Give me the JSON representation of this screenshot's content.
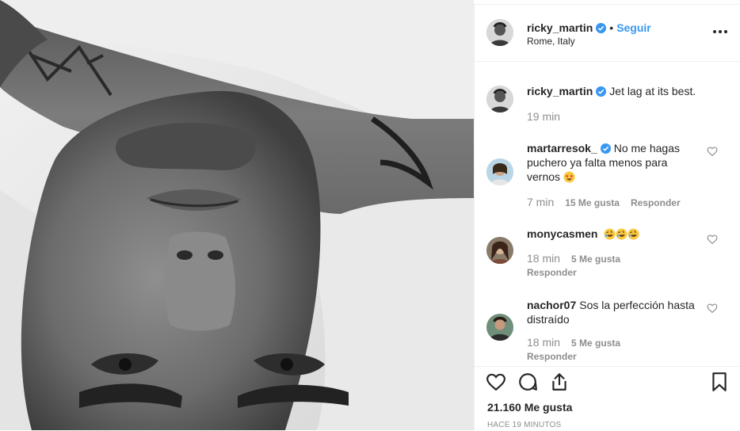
{
  "post": {
    "author": "ricky_martin",
    "location": "Rome, Italy",
    "follow_label": "Seguir",
    "separator": "•",
    "caption": {
      "username": "ricky_martin",
      "text": "Jet lag at its best.",
      "time": "19 min"
    },
    "comments": [
      {
        "username": "martarresok_",
        "verified": true,
        "text": "No me hagas puchero ya falta menos para vernos",
        "emoji": "star-struck-emoji",
        "time": "7 min",
        "likes": "15 Me gusta",
        "reply": "Responder"
      },
      {
        "username": "monycasmen",
        "verified": false,
        "text": "",
        "emoji": "rofl-emoji x3",
        "time": "18 min",
        "likes": "5 Me gusta",
        "reply": "Responder"
      },
      {
        "username": "nachor07",
        "verified": false,
        "text": "Sos la perfección hasta distraído",
        "time": "18 min",
        "likes": "5 Me gusta",
        "reply": "Responder"
      }
    ],
    "likes_count": "21.160 Me gusta",
    "posted_ago": "HACE 19 MINUTOS"
  },
  "icons": {
    "more": "more-options-icon",
    "like": "heart-icon",
    "comment": "comment-icon",
    "share": "share-icon",
    "save": "bookmark-icon",
    "verified": "verified-badge-icon"
  },
  "colors": {
    "accent": "#3897f0",
    "text": "#262626",
    "muted": "#8e8e8e",
    "border": "#efefef"
  }
}
